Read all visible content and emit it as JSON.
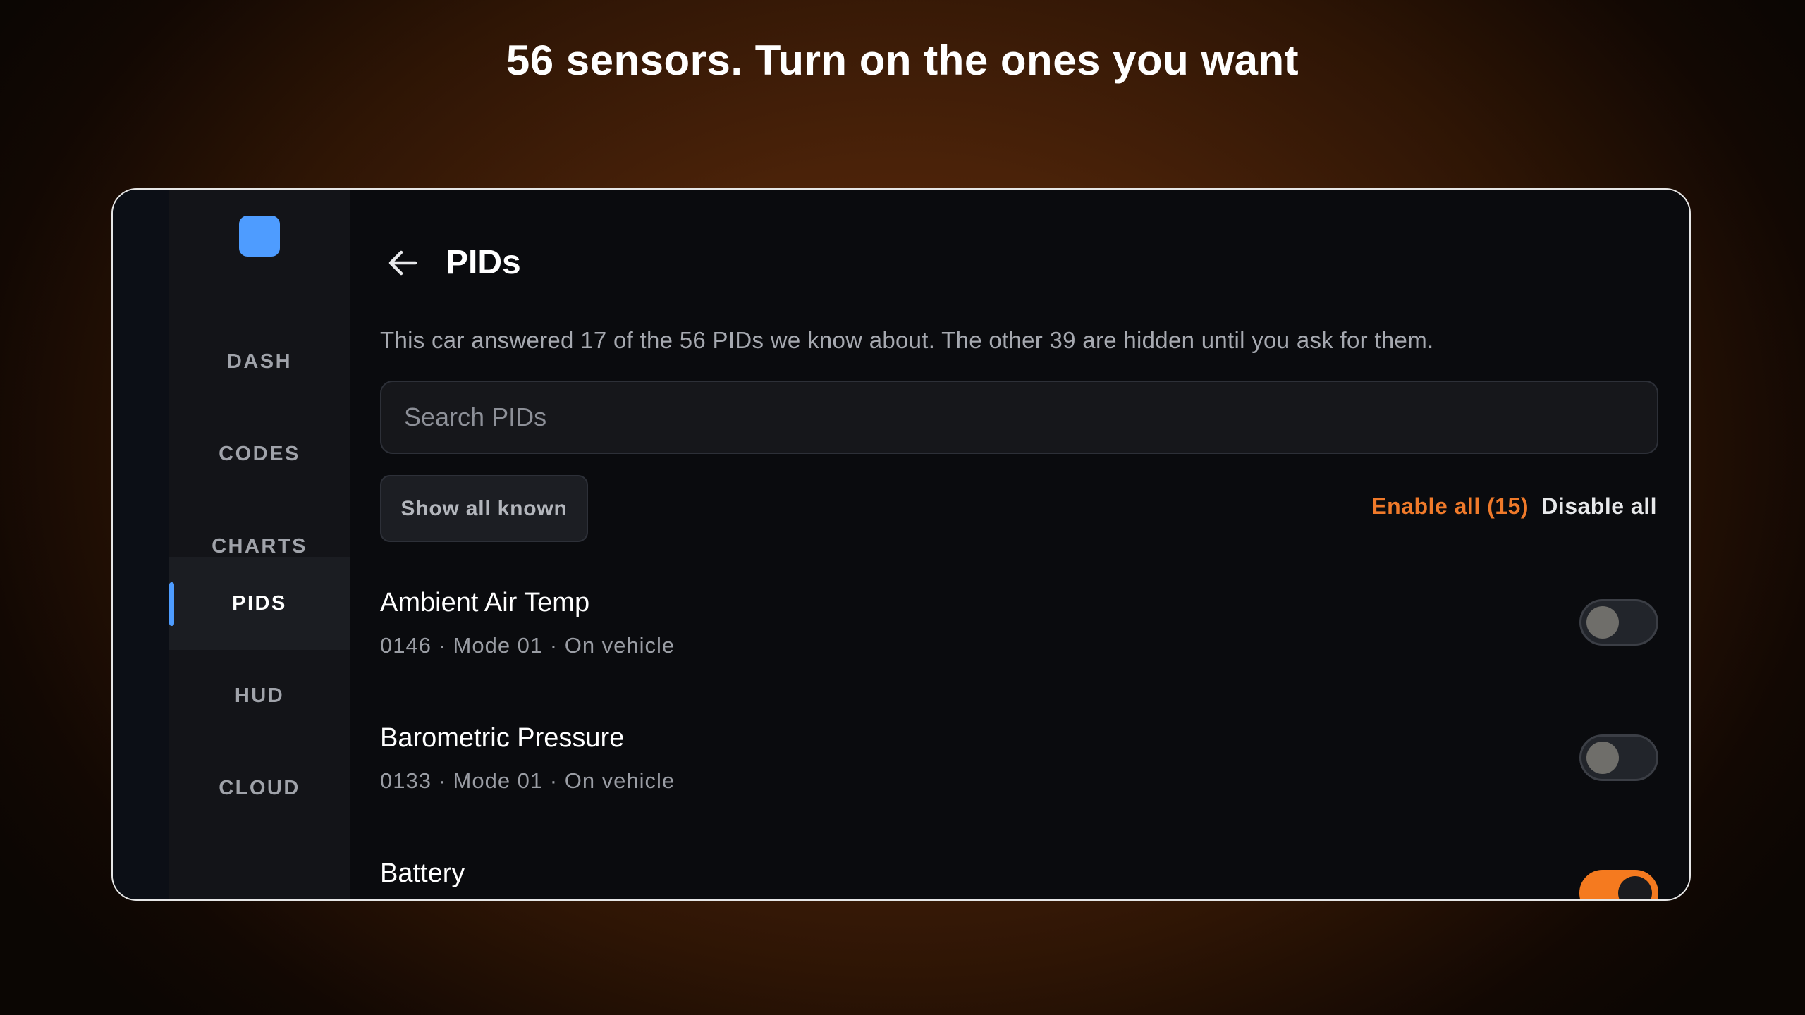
{
  "headline": "56 sensors. Turn on the ones you want",
  "colors": {
    "accent_blue": "#4e9cff",
    "accent_orange": "#f07a2a",
    "background": "#0a0b0e"
  },
  "sidebar": {
    "logo_icon": "app-logo-square",
    "items": [
      {
        "label": "DASH",
        "active": false
      },
      {
        "label": "CODES",
        "active": false
      },
      {
        "label": "CHARTS",
        "active": false
      },
      {
        "label": "PIDS",
        "active": true
      },
      {
        "label": "HUD",
        "active": false
      },
      {
        "label": "CLOUD",
        "active": false
      }
    ]
  },
  "header": {
    "back_icon": "arrow-left-icon",
    "title": "PIDs"
  },
  "description": "This car answered 17 of the 56 PIDs we know about. The other 39 are hidden until you ask for them.",
  "search": {
    "placeholder": "Search PIDs",
    "value": ""
  },
  "filters": {
    "show_all_known_label": "Show all known",
    "enable_all_label": "Enable all (15)",
    "disable_all_label": "Disable all"
  },
  "pids": [
    {
      "name": "Ambient Air Temp",
      "meta": "0146 · Mode 01 · On vehicle",
      "enabled": false
    },
    {
      "name": "Barometric Pressure",
      "meta": "0133 · Mode 01 · On vehicle",
      "enabled": false
    },
    {
      "name": "Battery",
      "meta": "",
      "enabled": true
    }
  ]
}
